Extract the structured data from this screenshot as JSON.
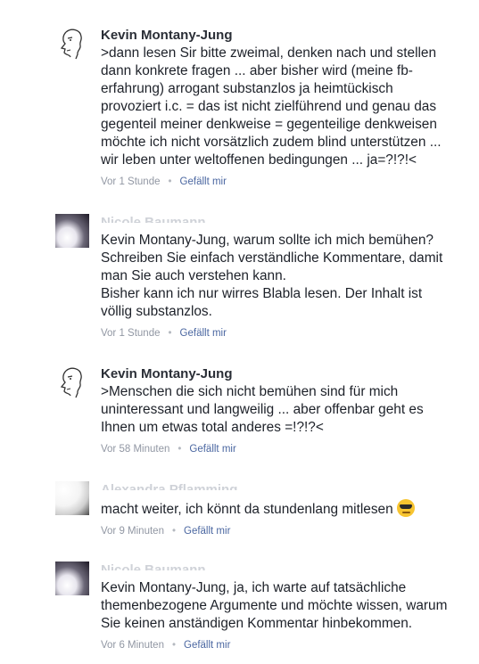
{
  "comments": [
    {
      "author": "Kevin Montany-Jung",
      "text": ">dann lesen Sir bitte zweimal, denken nach und stellen\ndann konkrete fragen ... aber bisher wird (meine fb-\nerfahrung)  arrogant substanzlos ja heimtückisch\nprovoziert i.c. = das ist nicht zielführend und genau das\ngegenteil meiner denkweise =  gegenteilige denkweisen\nmöchte ich nicht  vorsätzlich zudem blind unterstützen ...\nwir leben unter weltoffenen bedingungen  ... ja=?!?!<",
      "time": "Vor 1 Stunde",
      "like": "Gefällt mir"
    },
    {
      "author": "Nicole Baumann",
      "text": "Kevin Montany-Jung, warum sollte ich mich bemühen?\nSchreiben Sie einfach verständliche Kommentare, damit\nman Sie auch verstehen kann.\nBisher kann ich nur wirres Blabla lesen. Der Inhalt ist\nvöllig substanzlos.",
      "time": "Vor 1 Stunde",
      "like": "Gefällt mir"
    },
    {
      "author": "Kevin Montany-Jung",
      "text": ">Menschen die sich nicht bemühen sind für mich\nuninteressant und langweilig ... aber offenbar geht es\nIhnen um etwas total anderes =!?!?<",
      "time": "Vor 58 Minuten",
      "like": "Gefällt mir"
    },
    {
      "author": "Alexandra Pflamming",
      "text": "macht weiter, ich könnt da stundenlang mitlesen",
      "emoji": "sunglasses-emoji",
      "time": "Vor 9 Minuten",
      "like": "Gefällt mir"
    },
    {
      "author": "Nicole Baumann",
      "text": "Kevin Montany-Jung, ja, ich warte auf tatsächliche\nthemenbezogene Argumente und möchte wissen, warum\nSie keinen anständigen Kommentar hinbekommen.",
      "time": "Vor 6 Minuten",
      "like": "Gefällt mir"
    }
  ],
  "separator": "•"
}
